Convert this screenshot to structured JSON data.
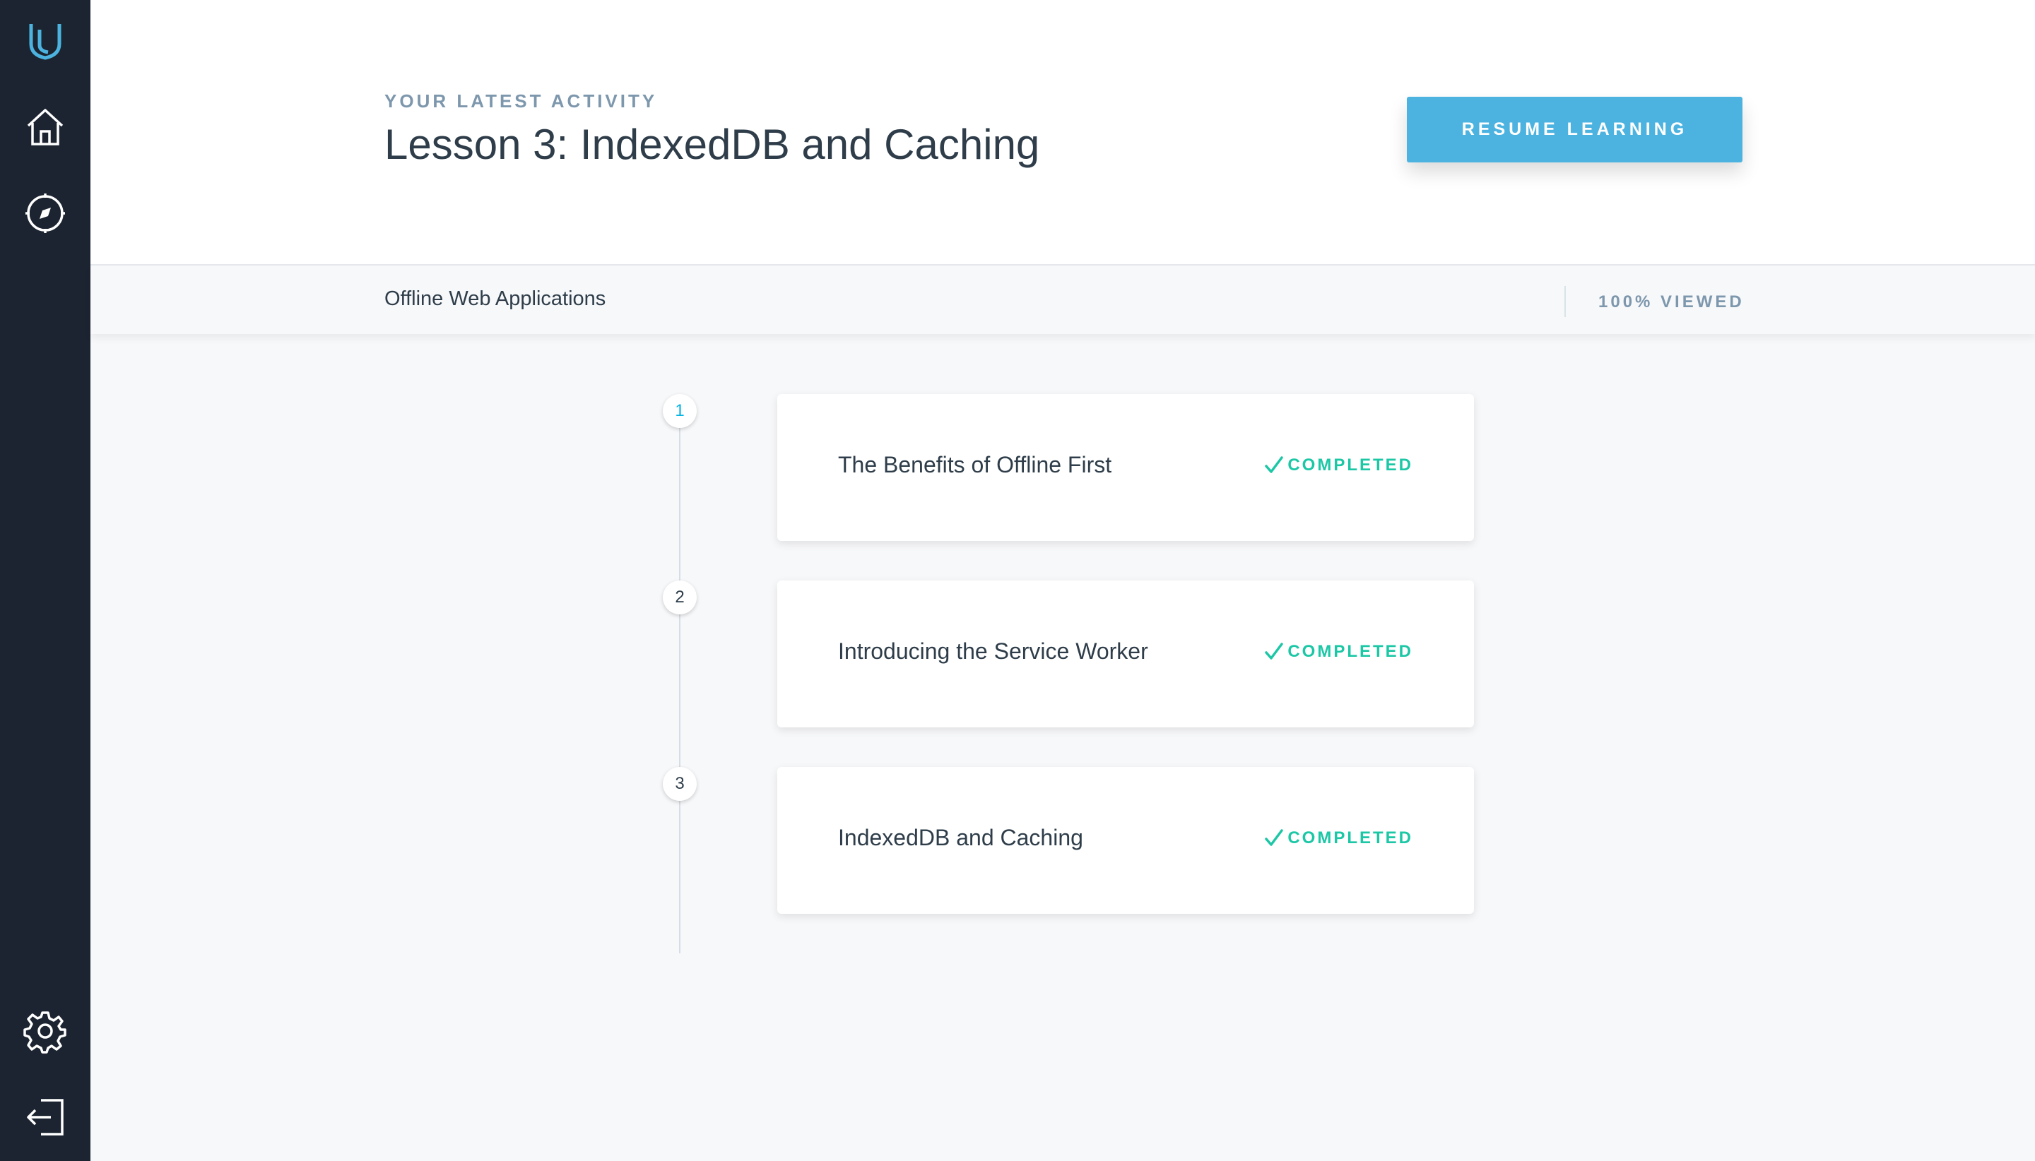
{
  "sidebar": {
    "icons": [
      "udacity-logo-icon",
      "home-icon",
      "compass-icon",
      "settings-gear-icon",
      "logout-icon"
    ]
  },
  "header": {
    "eyebrow": "YOUR LATEST ACTIVITY",
    "title": "Lesson 3: IndexedDB and Caching",
    "resume_label": "RESUME LEARNING"
  },
  "subbar": {
    "course": "Offline Web Applications",
    "progress": "100% VIEWED"
  },
  "lessons": [
    {
      "number": "1",
      "title": "The Benefits of Offline First",
      "status": "COMPLETED"
    },
    {
      "number": "2",
      "title": "Introducing the Service Worker",
      "status": "COMPLETED"
    },
    {
      "number": "3",
      "title": "IndexedDB and Caching",
      "status": "COMPLETED"
    }
  ],
  "colors": {
    "sidebar": "#1b2430",
    "accent": "#4cb3e0",
    "completed": "#1cc7a6"
  }
}
